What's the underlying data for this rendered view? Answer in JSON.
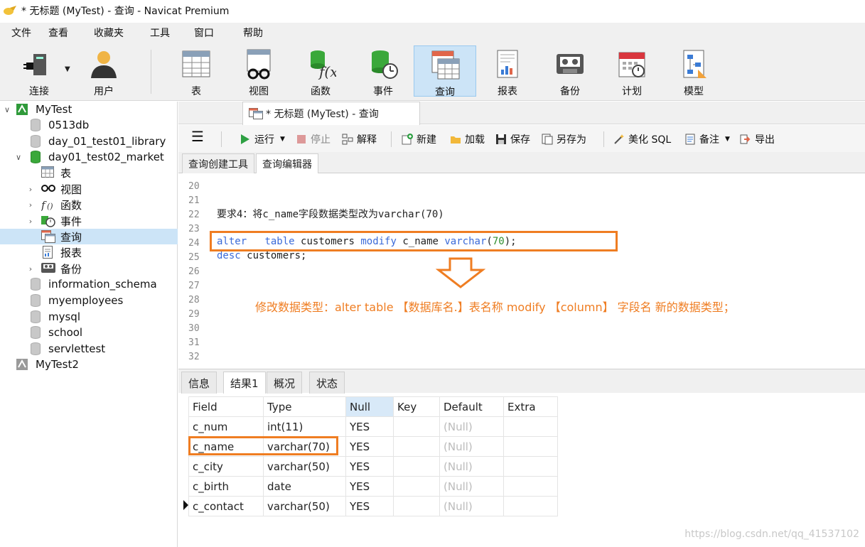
{
  "window": {
    "title": "* 无标题 (MyTest) - 查询 - Navicat Premium"
  },
  "menu": [
    "文件",
    "查看",
    "收藏夹",
    "工具",
    "窗口",
    "帮助"
  ],
  "toolbar": {
    "connect": "连接",
    "user": "用户",
    "table": "表",
    "view": "视图",
    "function": "函数",
    "event": "事件",
    "query": "查询",
    "report": "报表",
    "backup": "备份",
    "schedule": "计划",
    "model": "模型"
  },
  "tree": {
    "connection": "MyTest",
    "databases": [
      "0513db",
      "day_01_test01_library",
      "day01_test02_market"
    ],
    "market_children": [
      "表",
      "视图",
      "函数",
      "事件",
      "查询",
      "报表",
      "备份"
    ],
    "other_databases": [
      "information_schema",
      "myemployees",
      "mysql",
      "school",
      "servlettest"
    ],
    "connection2": "MyTest2"
  },
  "doc_tab": {
    "label": "* 无标题 (MyTest) - 查询"
  },
  "query_toolbar": {
    "run": "运行",
    "stop": "停止",
    "explain": "解释",
    "new": "新建",
    "load": "加载",
    "save": "保存",
    "save_as": "另存为",
    "beautify": "美化 SQL",
    "note": "备注",
    "export": "导出"
  },
  "sub_tabs": [
    "查询创建工具",
    "查询编辑器"
  ],
  "editor": {
    "line_numbers": [
      "20",
      "21",
      "22",
      "23",
      "24",
      "25",
      "26",
      "27",
      "28",
      "29",
      "30",
      "31",
      "32"
    ],
    "line22": "要求4：将c_name字段数据类型改为varchar(70)",
    "line24": {
      "kw1": "alter",
      "kw2": "table",
      "t1": "customers",
      "kw3": "modify",
      "t2": "c_name",
      "kw4": "varchar",
      "n": "70",
      "end": ");"
    },
    "line25": {
      "kw": "desc",
      "t": "customers;"
    },
    "annotation": "修改数据类型：alter table 【数据库名.】表名称   modify 【column】 字段名   新的数据类型；"
  },
  "bottom_tabs": [
    "信息",
    "结果1",
    "概况",
    "状态"
  ],
  "result": {
    "columns": [
      "Field",
      "Type",
      "Null",
      "Key",
      "Default",
      "Extra"
    ],
    "rows": [
      [
        "c_num",
        "int(11)",
        "YES",
        "",
        "(Null)",
        ""
      ],
      [
        "c_name",
        "varchar(70)",
        "YES",
        "",
        "(Null)",
        ""
      ],
      [
        "c_city",
        "varchar(50)",
        "YES",
        "",
        "(Null)",
        ""
      ],
      [
        "c_birth",
        "date",
        "YES",
        "",
        "(Null)",
        ""
      ],
      [
        "c_contact",
        "varchar(50)",
        "YES",
        "",
        "(Null)",
        ""
      ]
    ]
  },
  "watermark": "https://blog.csdn.net/qq_41537102",
  "colors": {
    "accent_orange": "#ef7d22",
    "selection": "#cce4f7",
    "keyword_blue": "#3a6ad8"
  }
}
